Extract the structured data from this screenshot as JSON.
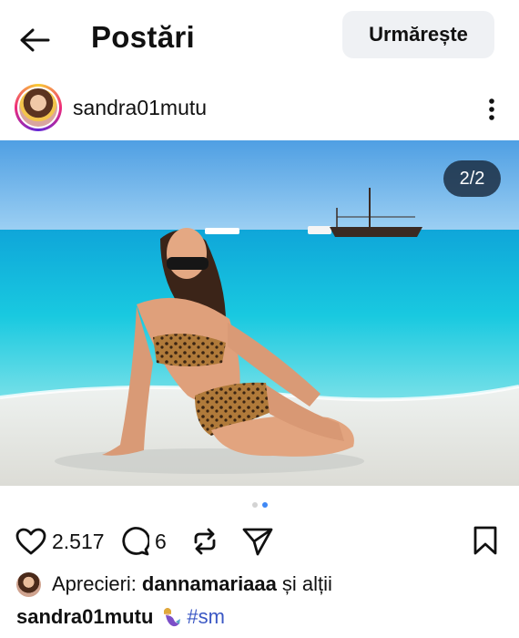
{
  "header": {
    "title": "Postări",
    "back_icon": "arrow-left-icon",
    "follow_label": "Urmărește"
  },
  "post": {
    "username": "sandra01mutu",
    "more_icon": "more-vertical-icon",
    "image_counter": "2/2",
    "carousel": {
      "total": 2,
      "current": 2
    }
  },
  "actions": {
    "like_count": "2.517",
    "comment_count": "6",
    "icons": [
      "heart-icon",
      "comment-icon",
      "repost-icon",
      "share-icon",
      "bookmark-icon"
    ]
  },
  "likes": {
    "label": "Aprecieri:",
    "user": "dannamariaaa",
    "rest": "și alții"
  },
  "caption": {
    "username": "sandra01mutu",
    "emoji": "mermaid-emoji",
    "hashtag": "#sm"
  },
  "colors": {
    "follow_button_bg": "#eff1f4",
    "hashtag": "#3a57c4",
    "active_dot": "#3f88f5",
    "sea": "#14c3dc",
    "sky": "#5fa8e6"
  }
}
